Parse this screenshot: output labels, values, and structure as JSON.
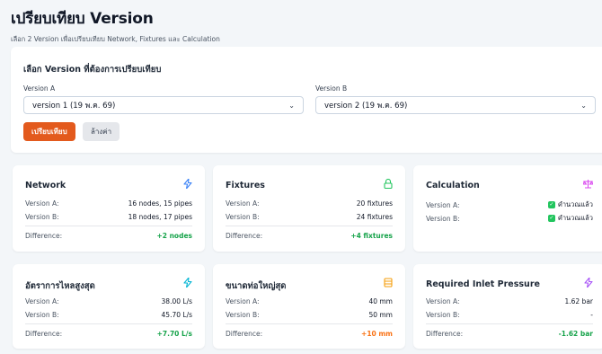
{
  "header": {
    "title": "เปรียบเทียบ Version",
    "subtitle": "เลือก 2 Version เพื่อเปรียบเทียบ Network, Fixtures และ Calculation"
  },
  "selector": {
    "title": "เลือก Version ที่ต้องการเปรียบเทียบ",
    "version_a_label": "Version A",
    "version_a_value": "version 1 (19 พ.ค. 69)",
    "version_b_label": "Version B",
    "version_b_value": "version 2 (19 พ.ค. 69)",
    "compare_button": "เปรียบเทียบ",
    "clear_button": "ล้างค่า"
  },
  "labels": {
    "version_a": "Version A:",
    "version_b": "Version B:",
    "difference": "Difference:"
  },
  "cards": {
    "network": {
      "title": "Network",
      "a": "16 nodes, 15 pipes",
      "b": "18 nodes, 17 pipes",
      "diff": "+2 nodes",
      "icon": "lightning-icon"
    },
    "fixtures": {
      "title": "Fixtures",
      "a": "20 fixtures",
      "b": "24 fixtures",
      "diff": "+4 fixtures",
      "icon": "lock-icon"
    },
    "calculation": {
      "title": "Calculation",
      "a": "คำนวณแล้ว",
      "b": "คำนวณแล้ว",
      "icon": "balance-icon"
    },
    "max_flow": {
      "title": "อัตราการไหลสูงสุด",
      "a": "38.00 L/s",
      "b": "45.70 L/s",
      "diff": "+7.70 L/s",
      "icon": "lightning-icon"
    },
    "max_pipe": {
      "title": "ขนาดท่อใหญ่สุด",
      "a": "40 mm",
      "b": "50 mm",
      "diff": "+10 mm",
      "icon": "document-icon"
    },
    "inlet_pressure": {
      "title": "Required Inlet Pressure",
      "a": "1.62 bar",
      "b": "-",
      "diff": "-1.62 bar",
      "icon": "lightning-icon"
    }
  },
  "colors": {
    "accent": "#e35a1d",
    "positive": "#16a34a",
    "warning": "#f97316",
    "negative": "#16a34a"
  }
}
